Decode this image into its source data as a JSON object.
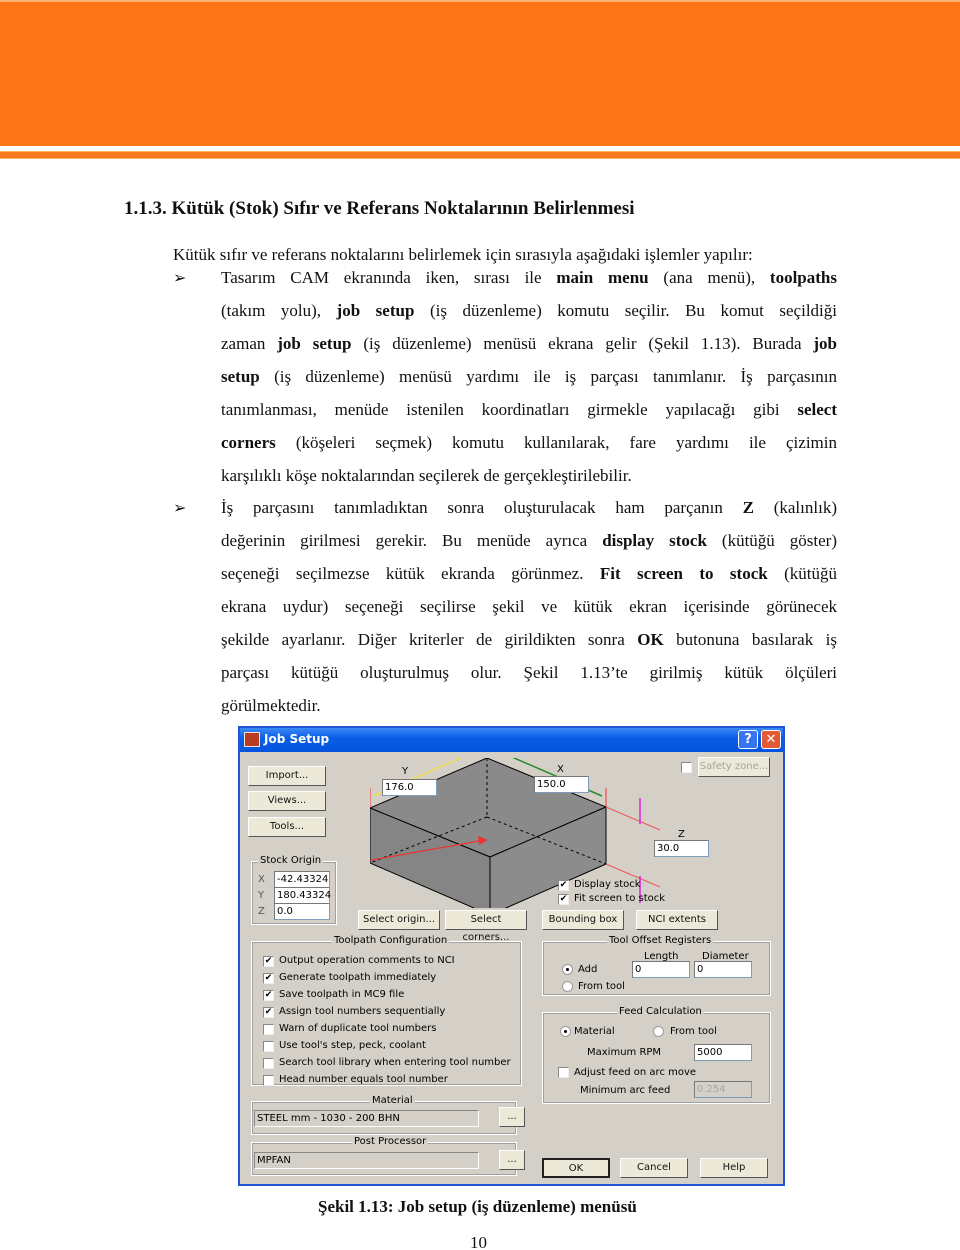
{
  "banner": {
    "color": "#fd7517"
  },
  "heading": "1.1.3. Kütük (Stok) Sıfır ve Referans Noktalarının Belirlenmesi",
  "intro": "Kütük sıfır ve referans noktalarını belirlemek için sırasıyla aşağıdaki işlemler yapılır:",
  "bullet_glyph": "➢",
  "bullets": [
    {
      "lines": [
        [
          "Tasarım CAM ekranında iken, sırası ile ",
          {
            "b": "main menu"
          },
          " (ana menü), ",
          {
            "b": "toolpaths"
          }
        ],
        [
          "(takım yolu), ",
          {
            "b": "job setup"
          },
          " (iş düzenleme) komutu seçilir. Bu komut seçildiği"
        ],
        [
          "zaman ",
          {
            "b": "job setup"
          },
          " (iş düzenleme) menüsü ekrana gelir (Şekil 1.13). Burada ",
          {
            "b": "job"
          }
        ],
        [
          {
            "b": "setup"
          },
          " (iş düzenleme) menüsü yardımı ile iş parçası tanımlanır. İş parçasının"
        ],
        [
          "tanımlanması, menüde istenilen koordinatları girmekle yapılacağı gibi ",
          {
            "b": "select"
          }
        ],
        [
          {
            "b": "corners"
          },
          " (köşeleri seçmek) komutu kullanılarak, fare yardımı ile çizimin"
        ],
        [
          "karşılıklı köşe noktalarından seçilerek de gerçekleştirilebilir."
        ]
      ]
    },
    {
      "lines": [
        [
          "İş parçasını tanımladıktan sonra oluşturulacak ham parçanın ",
          {
            "b": "Z"
          },
          " (kalınlık)"
        ],
        [
          "değerinin girilmesi gerekir. Bu menüde ayrıca ",
          {
            "b": "display stock"
          },
          " (kütüğü göster)"
        ],
        [
          "seçeneği seçilmezse kütük ekranda görünmez. ",
          {
            "b": "Fit screen to stock"
          },
          " (kütüğü"
        ],
        [
          "ekrana uydur) seçeneği seçilirse şekil ve kütük ekran içerisinde görünecek"
        ],
        [
          "şekilde ayarlanır. Diğer kriterler de girildikten sonra ",
          {
            "b": "OK"
          },
          " butonuna basılarak iş"
        ],
        [
          "parçası kütüğü oluşturulmuş olur. Şekil 1.13’te girilmiş kütük ölçüleri"
        ],
        [
          "görülmektedir."
        ]
      ]
    }
  ],
  "dialog": {
    "title": "Job Setup",
    "help_glyph": "?",
    "close_glyph": "✕",
    "buttons_left": [
      "Import...",
      "Views...",
      "Tools..."
    ],
    "safety_zone": {
      "checked": false,
      "label": "Safety zone..."
    },
    "dimensions": {
      "y_label": "Y",
      "y_value": "176.0",
      "x_label": "X",
      "x_value": "150.0",
      "z_label": "Z",
      "z_value": "30.0"
    },
    "stock_origin": {
      "title": "Stock Origin",
      "x_label": "X",
      "x_value": "-42.43324",
      "y_label": "Y",
      "y_value": "180.43324",
      "z_label": "Z",
      "z_value": "0.0"
    },
    "display_stock": {
      "checked": true,
      "label": "Display stock"
    },
    "fit_screen": {
      "checked": true,
      "label": "Fit screen to stock"
    },
    "action_buttons": [
      "Select origin...",
      "Select corners...",
      "Bounding box",
      "NCI extents"
    ],
    "toolpath_config": {
      "title": "Toolpath Configuration",
      "items": [
        {
          "label": "Output operation comments to NCI",
          "checked": true
        },
        {
          "label": "Generate toolpath immediately",
          "checked": true
        },
        {
          "label": "Save toolpath in MC9 file",
          "checked": true
        },
        {
          "label": "Assign tool numbers sequentially",
          "checked": true
        },
        {
          "label": "Warn of duplicate tool numbers",
          "checked": false
        },
        {
          "label": "Use tool's step, peck, coolant",
          "checked": false
        },
        {
          "label": "Search tool library when entering tool number",
          "checked": false
        },
        {
          "label": "Head number equals tool number",
          "checked": false
        }
      ]
    },
    "tool_offset": {
      "title": "Tool Offset Registers",
      "length_label": "Length",
      "diameter_label": "Diameter",
      "add_label": "Add",
      "from_tool_label": "From tool",
      "selected": "Add",
      "length_value": "0",
      "diameter_value": "0"
    },
    "feed_calc": {
      "title": "Feed Calculation",
      "material_label": "Material",
      "from_tool_label": "From tool",
      "selected": "Material",
      "max_rpm_label": "Maximum RPM",
      "max_rpm_value": "5000",
      "adjust_label": "Adjust feed on arc move",
      "adjust_checked": false,
      "min_arc_label": "Minimum arc feed",
      "min_arc_value": "0.254"
    },
    "material": {
      "title": "Material",
      "value": "STEEL mm - 1030 - 200 BHN",
      "browse": "..."
    },
    "post_processor": {
      "title": "Post Processor",
      "value": "MPFAN",
      "browse": "..."
    },
    "ok": "OK",
    "cancel": "Cancel",
    "help": "Help",
    "check_glyph": "✔"
  },
  "caption": "Şekil 1.13: Job setup (iş düzenleme) menüsü",
  "page_number": "10"
}
